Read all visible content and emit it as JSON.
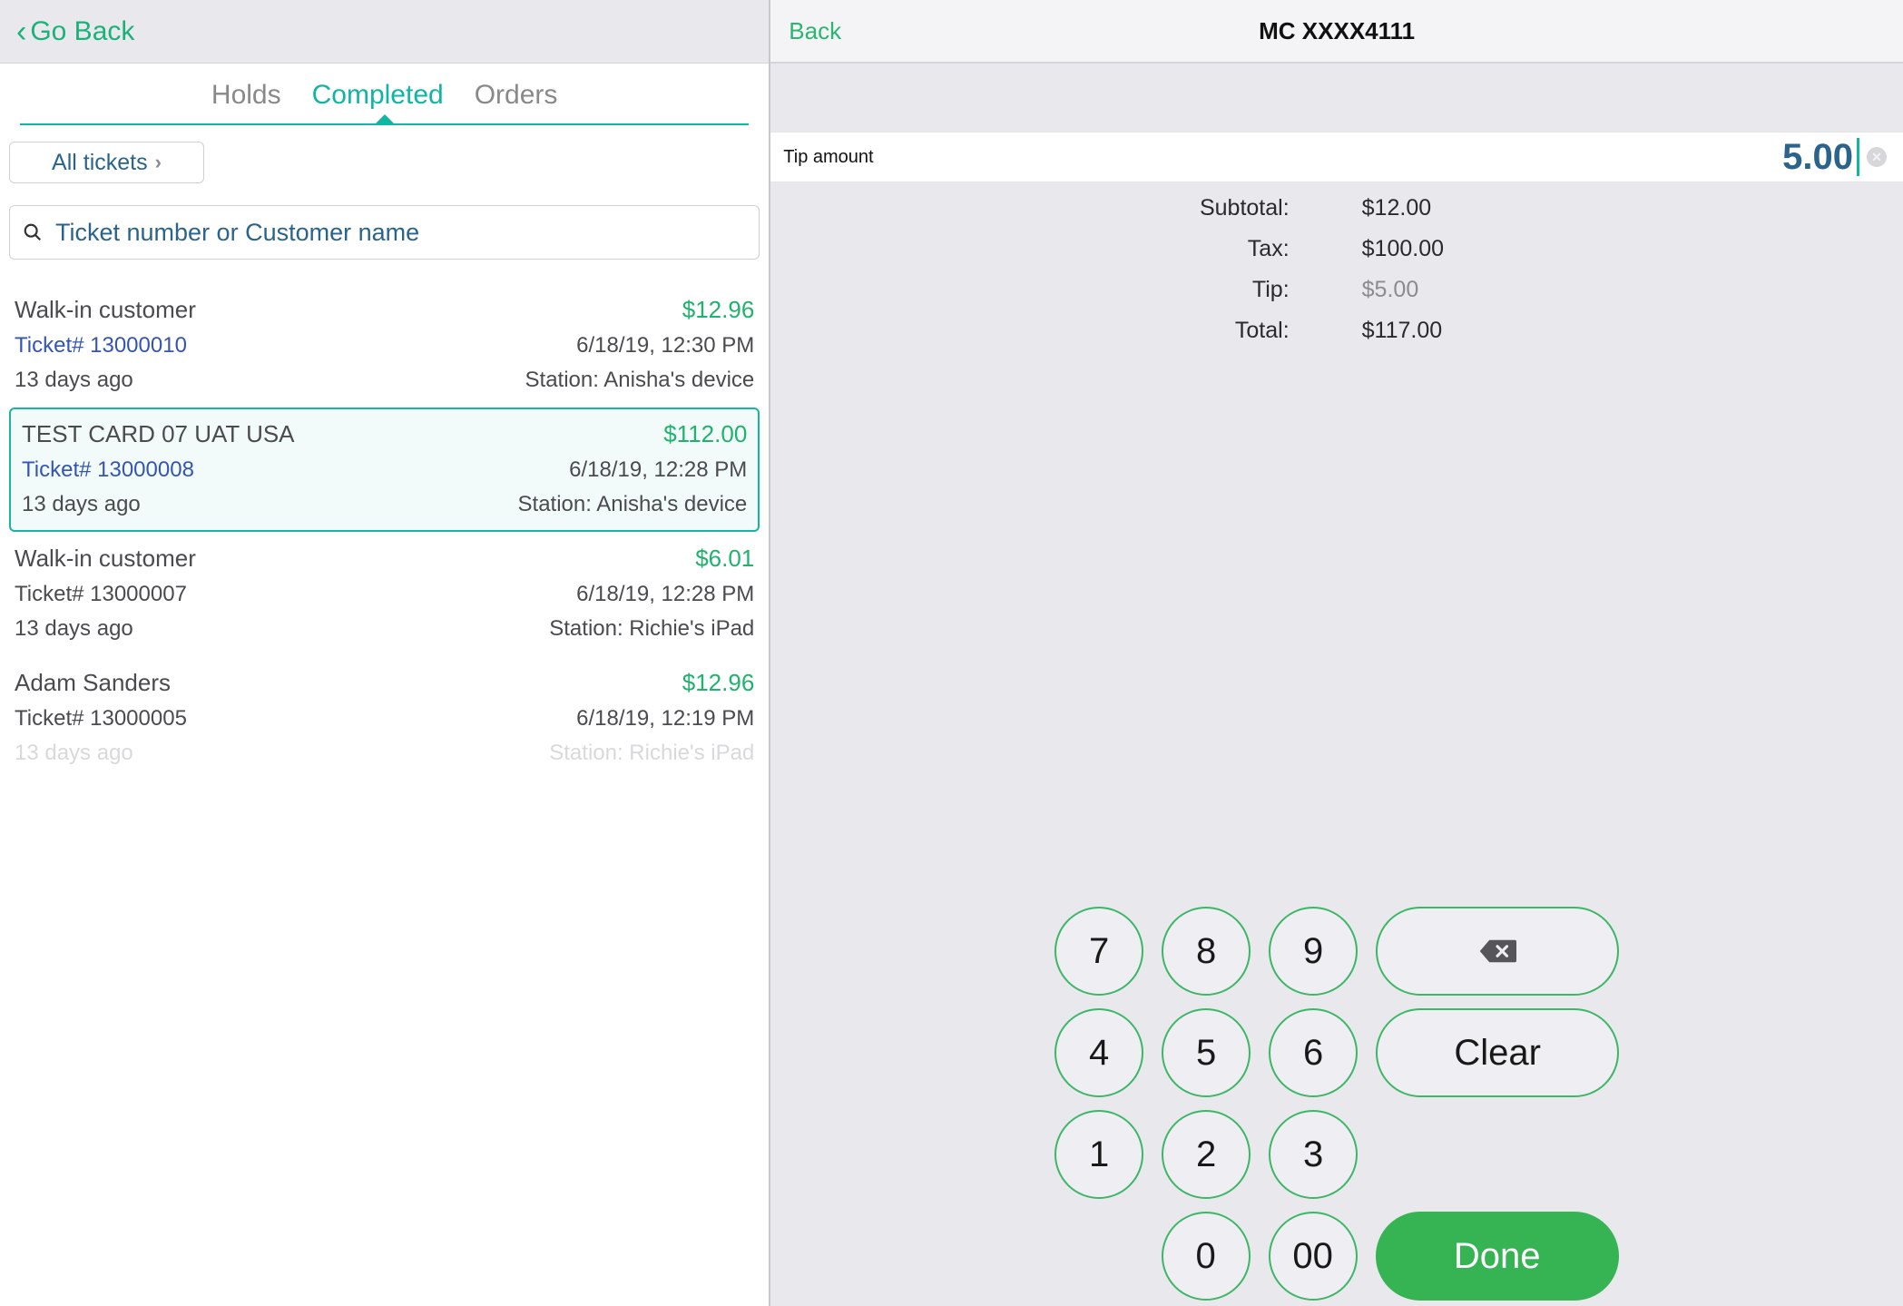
{
  "left": {
    "go_back": "Go Back",
    "tabs": {
      "holds": "Holds",
      "completed": "Completed",
      "orders": "Orders"
    },
    "filter": "All tickets",
    "search_placeholder": "Ticket number or Customer name"
  },
  "tickets": [
    {
      "customer": "Walk-in customer",
      "amount": "$12.96",
      "ticket": "Ticket# 13000010",
      "datetime": "6/18/19, 12:30 PM",
      "ago": "13 days ago",
      "station": "Station: Anisha's device",
      "link": true
    },
    {
      "customer": "TEST CARD 07 UAT USA",
      "amount": "$112.00",
      "ticket": "Ticket# 13000008",
      "datetime": "6/18/19, 12:28 PM",
      "ago": "13 days ago",
      "station": "Station: Anisha's device",
      "selected": true,
      "link": true
    },
    {
      "customer": "Walk-in customer",
      "amount": "$6.01",
      "ticket": "Ticket# 13000007",
      "datetime": "6/18/19, 12:28 PM",
      "ago": "13 days ago",
      "station": "Station: Richie's iPad"
    },
    {
      "customer": "Adam Sanders",
      "amount": "$12.96",
      "ticket": "Ticket# 13000005",
      "datetime": "6/18/19, 12:19 PM",
      "ago": "13 days ago",
      "station": "Station: Richie's iPad",
      "faded": true
    }
  ],
  "right": {
    "back": "Back",
    "title": "MC XXXX4111",
    "tip_label": "Tip amount",
    "tip_value": "5.00",
    "totals": {
      "subtotal_label": "Subtotal:",
      "subtotal": "$12.00",
      "tax_label": "Tax:",
      "tax": "$100.00",
      "tip_label": "Tip:",
      "tip": "$5.00",
      "total_label": "Total:",
      "total": "$117.00"
    },
    "keys": {
      "k7": "7",
      "k8": "8",
      "k9": "9",
      "k4": "4",
      "k5": "5",
      "k6": "6",
      "k1": "1",
      "k2": "2",
      "k3": "3",
      "k0": "0",
      "k00": "00",
      "clear": "Clear",
      "done": "Done"
    }
  }
}
